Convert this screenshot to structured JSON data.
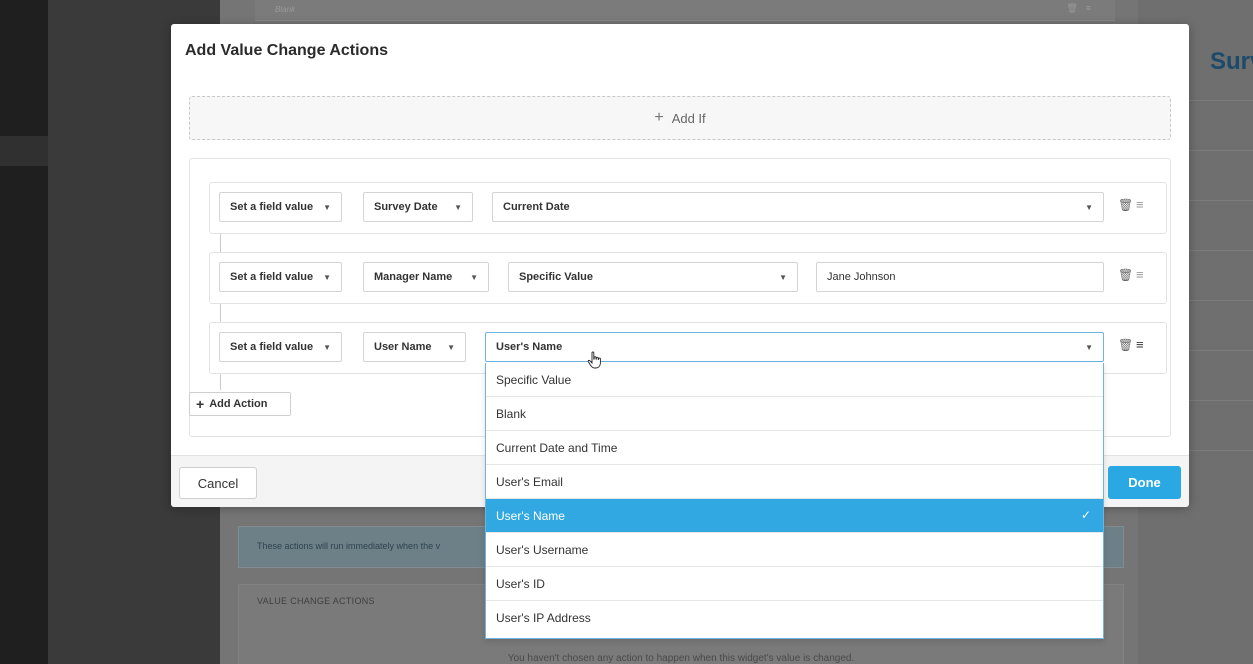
{
  "background": {
    "top_row_blank": "Blank",
    "right_title": "Surv",
    "info_text": "These actions will run immediately when the v",
    "vca_header": "VALUE CHANGE ACTIONS",
    "vca_empty": "You haven't chosen any action to happen when this widget's value is changed."
  },
  "modal": {
    "title": "Add Value Change Actions",
    "add_if_label": "Add If",
    "add_action_label": "Add Action",
    "cancel_label": "Cancel",
    "done_label": "Done"
  },
  "actions": [
    {
      "type": "Set a field value",
      "field": "Survey Date",
      "source": "Current Date",
      "value": ""
    },
    {
      "type": "Set a field value",
      "field": "Manager Name",
      "source": "Specific Value",
      "value": "Jane Johnson"
    },
    {
      "type": "Set a field value",
      "field": "User Name",
      "source": "User's Name",
      "value": ""
    }
  ],
  "dropdown": {
    "options": [
      "Specific Value",
      "Blank",
      "Current Date and Time",
      "User's Email",
      "User's Name",
      "User's Username",
      "User's ID",
      "User's IP Address"
    ],
    "selected": "User's Name"
  },
  "colors": {
    "primary": "#2aa8e3",
    "selected_option": "#31a8e1",
    "focus_border": "#6fb3de"
  }
}
